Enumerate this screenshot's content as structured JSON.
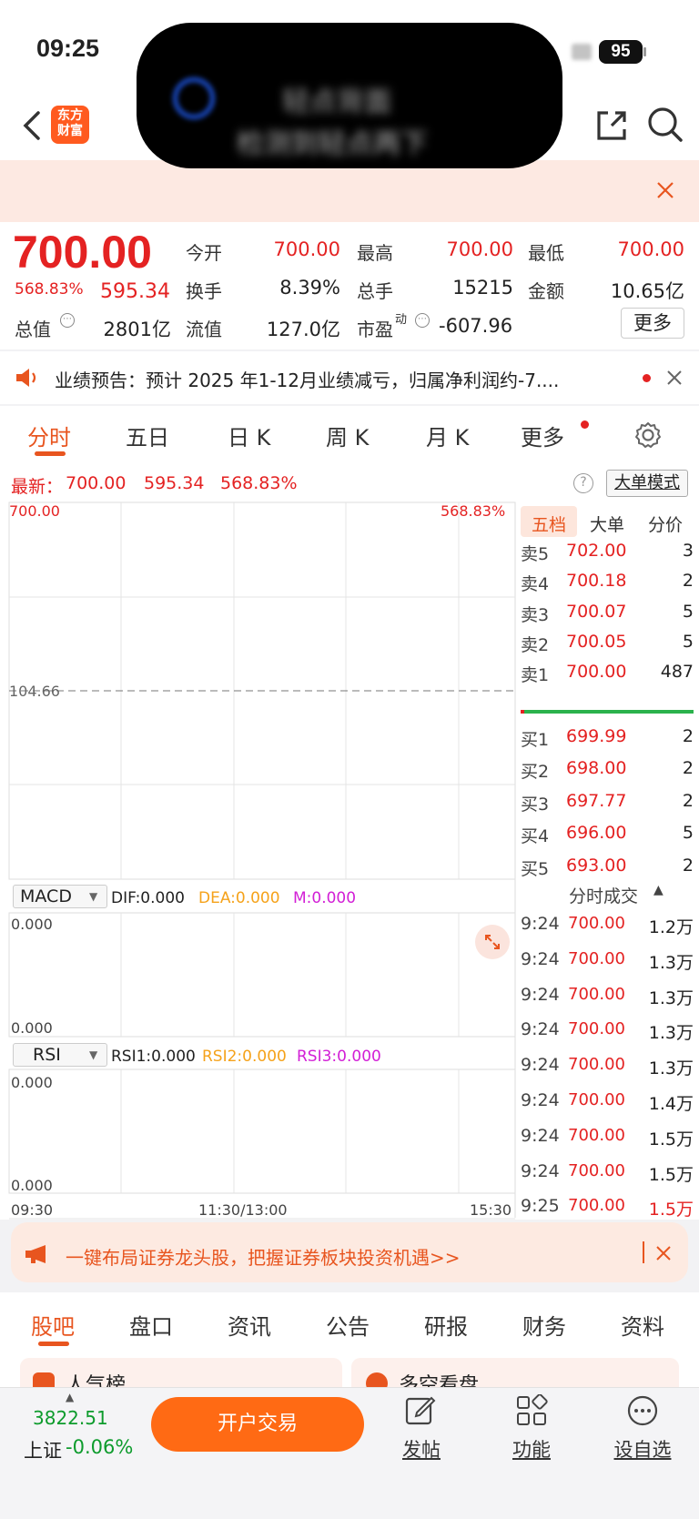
{
  "status_bar": {
    "time": "09:25",
    "battery": "95"
  },
  "island": {
    "line1": "轻点背面",
    "line2": "检测到轻点两下"
  },
  "nav": {
    "logo_line1": "东方",
    "logo_line2": "财富"
  },
  "quote": {
    "price": "700.00",
    "change_pct": "568.83%",
    "change_abs": "595.34",
    "row1": [
      {
        "label": "今开",
        "value": "700.00"
      },
      {
        "label": "最高",
        "value": "700.00"
      },
      {
        "label": "最低",
        "value": "700.00"
      }
    ],
    "row2": [
      {
        "label": "换手",
        "value": "8.39%"
      },
      {
        "label": "总手",
        "value": "15215"
      },
      {
        "label": "金额",
        "value": "10.65亿"
      }
    ],
    "row3": [
      {
        "label": "总值",
        "value": "2801亿"
      },
      {
        "label": "流值",
        "value": "127.0亿"
      },
      {
        "label": "市盈",
        "label_sup": "动",
        "value": "-607.96"
      }
    ],
    "more": "更多"
  },
  "notice": {
    "text": "业绩预告：预计 2025 年1-12月业绩减亏，归属净利润约-7...."
  },
  "tabs": [
    "分时",
    "五日",
    "日 K",
    "周 K",
    "月 K",
    "更多"
  ],
  "chart_header": {
    "latest_label": "最新：",
    "latest_price": "700.00",
    "latest_change": "595.34",
    "latest_pct": "568.83%",
    "big_order_mode": "大单模式"
  },
  "chart_data": {
    "type": "line",
    "title": "",
    "x_ticks": [
      "09:30",
      "11:30/13:00",
      "15:30"
    ],
    "y_top_left": "700.00",
    "y_top_right": "568.83%",
    "prev_close": "104.66",
    "series": [],
    "ylim": [
      104.66,
      700.0
    ]
  },
  "orderbook": {
    "tabs": [
      "五档",
      "大单",
      "分价"
    ],
    "asks": [
      {
        "label": "卖5",
        "price": "702.00",
        "vol": "3"
      },
      {
        "label": "卖4",
        "price": "700.18",
        "vol": "2"
      },
      {
        "label": "卖3",
        "price": "700.07",
        "vol": "5"
      },
      {
        "label": "卖2",
        "price": "700.05",
        "vol": "5"
      },
      {
        "label": "卖1",
        "price": "700.00",
        "vol": "487"
      }
    ],
    "bids": [
      {
        "label": "买1",
        "price": "699.99",
        "vol": "2"
      },
      {
        "label": "买2",
        "price": "698.00",
        "vol": "2"
      },
      {
        "label": "买3",
        "price": "697.77",
        "vol": "2"
      },
      {
        "label": "买4",
        "price": "696.00",
        "vol": "5"
      },
      {
        "label": "买5",
        "price": "693.00",
        "vol": "2"
      }
    ]
  },
  "trades": {
    "title": "分时成交",
    "rows": [
      {
        "time": "9:24",
        "price": "700.00",
        "vol": "1.2万"
      },
      {
        "time": "9:24",
        "price": "700.00",
        "vol": "1.3万"
      },
      {
        "time": "9:24",
        "price": "700.00",
        "vol": "1.3万"
      },
      {
        "time": "9:24",
        "price": "700.00",
        "vol": "1.3万"
      },
      {
        "time": "9:24",
        "price": "700.00",
        "vol": "1.3万"
      },
      {
        "time": "9:24",
        "price": "700.00",
        "vol": "1.4万"
      },
      {
        "time": "9:24",
        "price": "700.00",
        "vol": "1.5万"
      },
      {
        "time": "9:24",
        "price": "700.00",
        "vol": "1.5万"
      },
      {
        "time": "9:25",
        "price": "700.00",
        "vol": "1.5万"
      }
    ]
  },
  "macd": {
    "name": "MACD",
    "dif": "DIF:0.000",
    "dea": "DEA:0.000",
    "m": "M:0.000",
    "top": "0.000",
    "bottom": "0.000"
  },
  "rsi": {
    "name": "RSI",
    "rsi1": "RSI1:0.000",
    "rsi2": "RSI2:0.000",
    "rsi3": "RSI3:0.000",
    "top": "0.000",
    "bottom": "0.000"
  },
  "ad": {
    "text": "一键布局证券龙头股，把握证券板块投资机遇>>"
  },
  "subtabs": [
    "股吧",
    "盘口",
    "资讯",
    "公告",
    "研报",
    "财务",
    "资料"
  ],
  "feed": {
    "left": "人气榜",
    "right": "多空看盘"
  },
  "bottom": {
    "index_value": "3822.51",
    "index_name": "上证",
    "index_change": "-0.06%",
    "trade": "开户交易",
    "post": "发帖",
    "func": "功能",
    "watch": "设自选"
  },
  "colors": {
    "up": "#e42222",
    "down": "#0d9b2c",
    "accent": "#ff6a14"
  }
}
